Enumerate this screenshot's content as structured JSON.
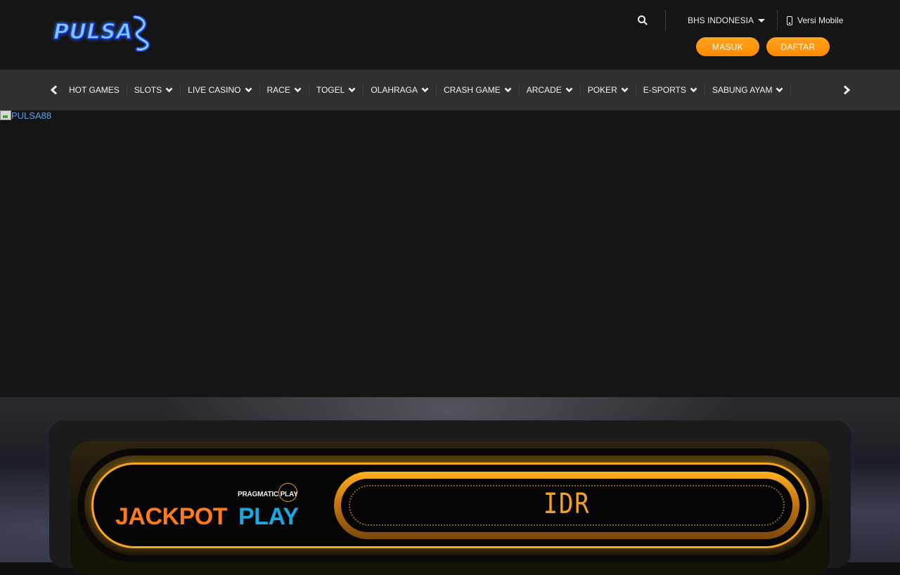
{
  "brand": {
    "logo_text": "PULSA"
  },
  "header": {
    "language": "BHS INDONESIA",
    "mobile_label": "Versi Mobile",
    "login_label": "MASUK",
    "register_label": "DAFTAR"
  },
  "nav": {
    "items": [
      {
        "label": "HOT GAMES",
        "has_dropdown": false
      },
      {
        "label": "SLOTS",
        "has_dropdown": true
      },
      {
        "label": "LIVE CASINO",
        "has_dropdown": true
      },
      {
        "label": "RACE",
        "has_dropdown": true
      },
      {
        "label": "TOGEL",
        "has_dropdown": true
      },
      {
        "label": "OLAHRAGA",
        "has_dropdown": true
      },
      {
        "label": "CRASH GAME",
        "has_dropdown": true
      },
      {
        "label": "ARCADE",
        "has_dropdown": true
      },
      {
        "label": "POKER",
        "has_dropdown": true
      },
      {
        "label": "E-SPORTS",
        "has_dropdown": true
      },
      {
        "label": "SABUNG AYAM",
        "has_dropdown": true
      }
    ]
  },
  "banner": {
    "alt_text": "PULSA88"
  },
  "jackpot": {
    "provider": "PRAGMATIC PLAY",
    "title_part1": "JACKPOT",
    "title_part2": "PLAY",
    "counter": "IDR"
  },
  "colors": {
    "accent_orange": "#ff8a00",
    "jackpot_orange": "#ff7a1a",
    "jackpot_blue": "#1aa8e0",
    "gold": "#f5a623"
  }
}
